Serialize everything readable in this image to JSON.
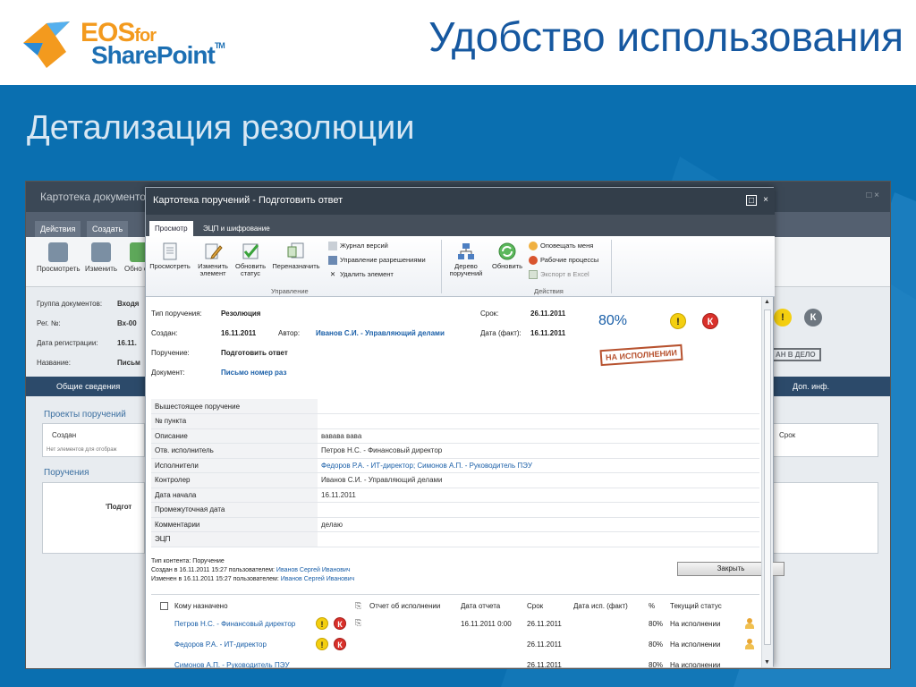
{
  "slide": {
    "logo_eos": "EOS",
    "logo_for": "for",
    "logo_sharepoint": "SharePoint",
    "logo_tm": "TM",
    "title": "Удобство использования",
    "subtitle": "Детализация резолюции"
  },
  "background_window": {
    "title": "Картотека документов",
    "tabs": [
      "Действия",
      "Создать"
    ],
    "ribbon_buttons": [
      "Просмотреть",
      "Изменить",
      "Обно ста"
    ],
    "fields": [
      {
        "label": "Группа документов:",
        "value": "Входя"
      },
      {
        "label": "Рег. №:",
        "value": "Вх-00"
      },
      {
        "label": "Дата регистрации:",
        "value": "16.11."
      },
      {
        "label": "Название:",
        "value": "Письм"
      }
    ],
    "bar_left": "Общие сведения",
    "bar_right": "Доп. инф.",
    "section_projects": "Проекты поручений",
    "projects_col": "Создан",
    "projects_empty": "Нет элементов для отображ",
    "section_tasks": "Поручения",
    "tasks_partial": "'Подгот",
    "right_col": "Срок",
    "stamp_partial": "АН В ДЕЛО",
    "badge_k": "К"
  },
  "dialog": {
    "title": "Картотека поручений - Подготовить ответ",
    "maximize_icon": "□",
    "close_icon": "×",
    "tabs": [
      "Просмотр",
      "ЭЦП и шифрование"
    ],
    "ribbon": {
      "buttons": [
        "Просмотреть",
        "Изменить элемент",
        "Обновить статус",
        "Переназначить"
      ],
      "small_manage": [
        "Журнал версий",
        "Управление разрешениями",
        "Удалить элемент"
      ],
      "group_manage": "Управление",
      "actions_buttons": [
        "Дерево поручений",
        "Обновить"
      ],
      "small_actions": [
        "Оповещать меня",
        "Рабочие процессы",
        "Экспорт в Excel"
      ],
      "group_actions": "Действия"
    },
    "header": {
      "type_label": "Тип поручения:",
      "type_value": "Резолюция",
      "created_label": "Создан:",
      "created_value": "16.11.2011",
      "author_label": "Автор:",
      "author_value": "Иванов С.И. - Управляющий делами",
      "order_label": "Поручение:",
      "order_value": "Подготовить ответ",
      "doc_label": "Документ:",
      "doc_value": "Письмо номер раз",
      "due_label": "Срок:",
      "due_value": "26.11.2011",
      "fact_label": "Дата (факт):",
      "fact_value": "16.11.2011",
      "percent": "80%",
      "badge_warn": "!",
      "badge_k": "К",
      "stamp": "НА ИСПОЛНЕНИИ"
    },
    "properties": [
      {
        "k": "Вышестоящее поручение",
        "v": ""
      },
      {
        "k": "№ пункта",
        "v": ""
      },
      {
        "k": "Описание",
        "v": "вавава вава"
      },
      {
        "k": "Отв. исполнитель",
        "v": "Петров Н.С. - Финансовый директор"
      },
      {
        "k": "Исполнители",
        "v": "Федоров Р.А. - ИТ-директор; Симонов А.П. - Руководитель ПЭУ"
      },
      {
        "k": "Контролер",
        "v": "Иванов С.И. - Управляющий делами"
      },
      {
        "k": "Дата начала",
        "v": "16.11.2011"
      },
      {
        "k": "Промежуточная дата",
        "v": ""
      },
      {
        "k": "Комментарии",
        "v": "делаю"
      },
      {
        "k": "ЭЦП",
        "v": ""
      }
    ],
    "meta": {
      "content_type": "Тип контента: Поручение",
      "created_text": "Создан в 16.11.2011 15:27 пользователем:",
      "created_user": "Иванов Сергей Иванович",
      "modified_text": "Изменен в 16.11.2011 15:27 пользователем:",
      "modified_user": "Иванов Сергей Иванович"
    },
    "close_button": "Закрыть",
    "list": {
      "headers": [
        "Кому назначено",
        "Отчет об исполнении",
        "Дата отчета",
        "Срок",
        "Дата исп. (факт)",
        "%",
        "Текущий статус"
      ],
      "rows": [
        {
          "who": "Петров Н.С. - Финансовый директор",
          "report_date": "16.11.2011 0:00",
          "due": "26.11.2011",
          "pct": "80%",
          "status": "На исполнении"
        },
        {
          "who": "Федоров Р.А. - ИТ-директор",
          "report_date": "",
          "due": "26.11.2011",
          "pct": "80%",
          "status": "На исполнении"
        },
        {
          "who": "Симонов А.П. - Руководитель ПЭУ",
          "report_date": "",
          "due": "26.11.2011",
          "pct": "80%",
          "status": "На исполнении"
        }
      ]
    }
  },
  "colors": {
    "slide_bg": "#0a6fb0",
    "title_blue": "#1658a0",
    "logo_orange": "#f39a1e",
    "link_blue": "#1a5fa8",
    "warn_yellow": "#f4cf10",
    "alert_red": "#d9302a"
  }
}
